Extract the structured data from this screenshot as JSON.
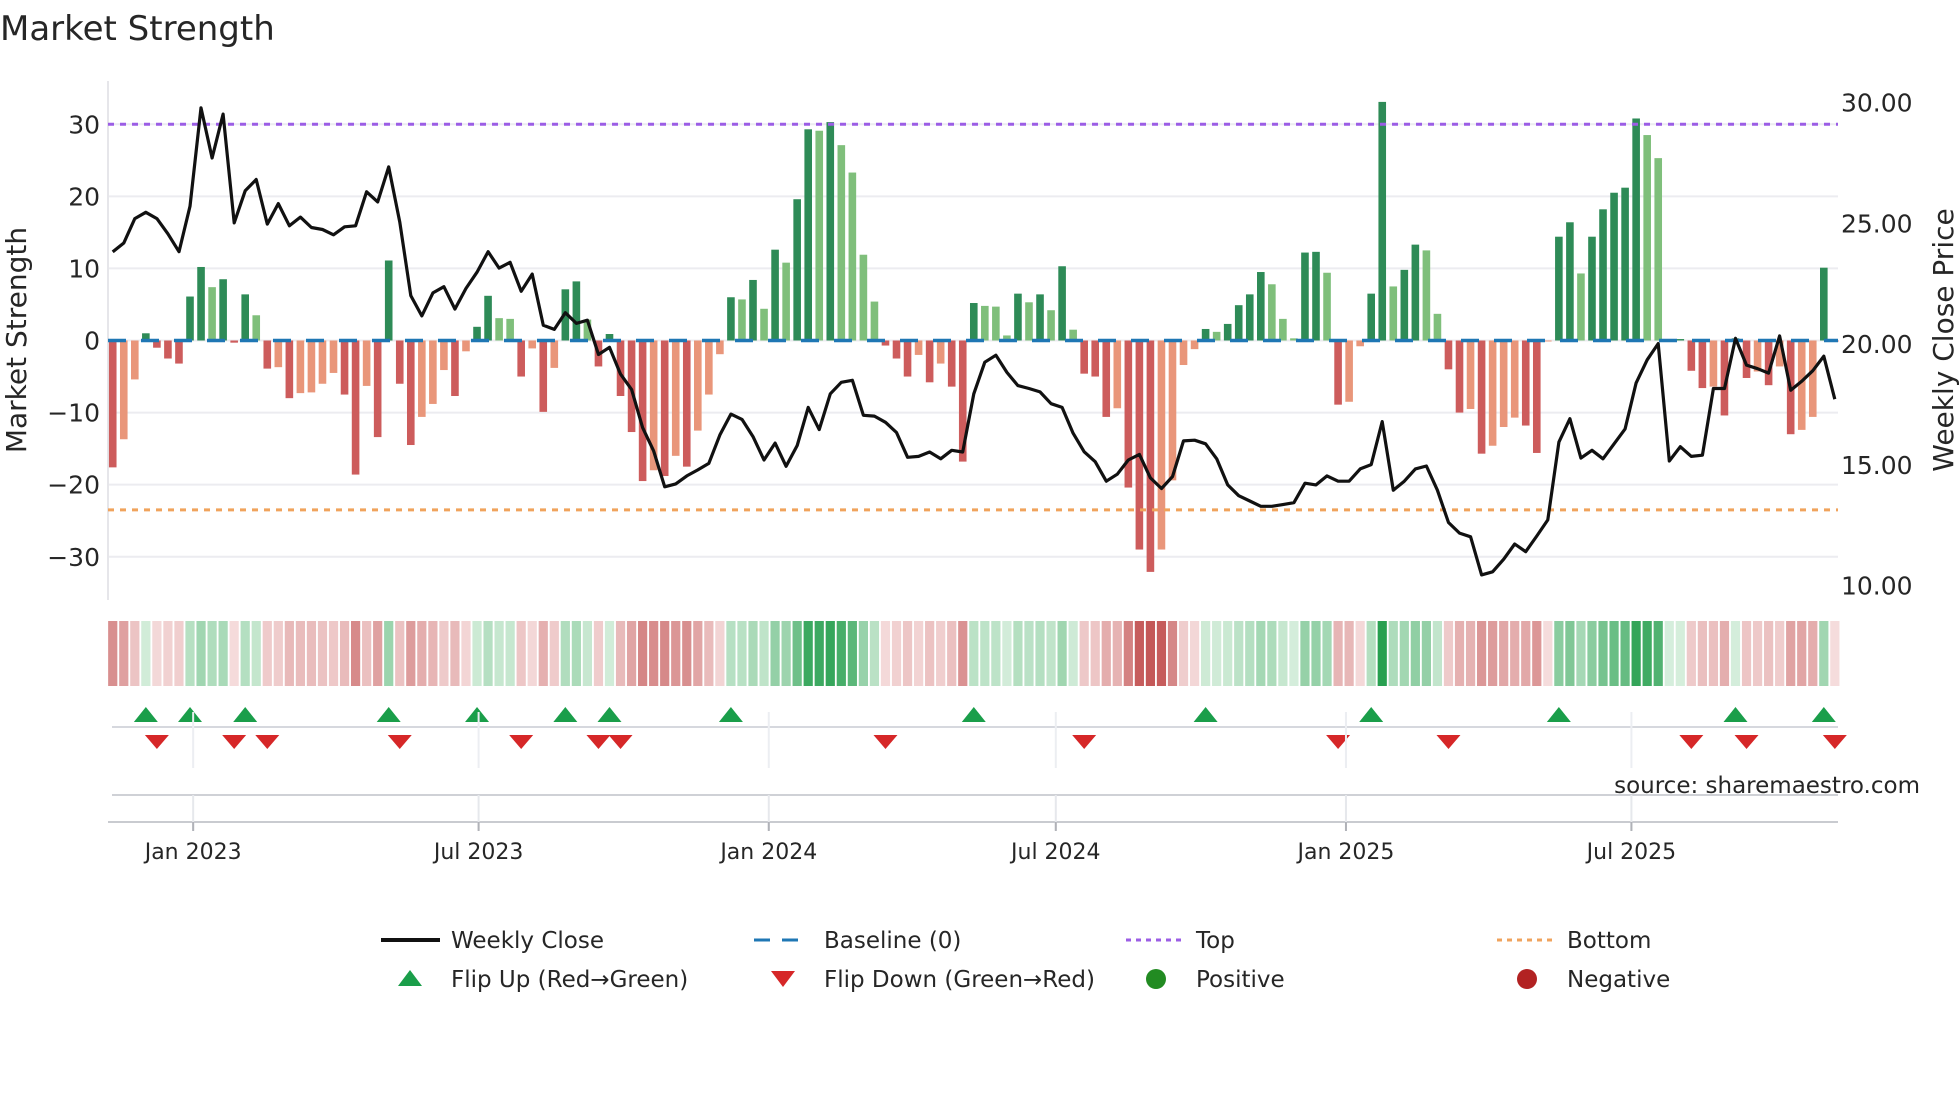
{
  "chart_data": {
    "type": "bar",
    "title": "Market Strength",
    "source": "source: sharemaestro.com",
    "x_start": "2022-11-11",
    "x_step_days": 7,
    "xlim": [
      "2022-11-08",
      "2025-11-09"
    ],
    "xticks": [
      {
        "date": "2023-01-01",
        "label": "Jan 2023"
      },
      {
        "date": "2023-07-01",
        "label": "Jul 2023"
      },
      {
        "date": "2024-01-01",
        "label": "Jan 2024"
      },
      {
        "date": "2024-07-01",
        "label": "Jul 2024"
      },
      {
        "date": "2025-01-01",
        "label": "Jan 2025"
      },
      {
        "date": "2025-07-01",
        "label": "Jul 2025"
      }
    ],
    "left_axis": {
      "label": "Market Strength",
      "ylim": [
        -36,
        36
      ],
      "ticks": [
        30,
        20,
        10,
        0,
        -10,
        -20,
        -30
      ],
      "tick_labels": [
        "30",
        "20",
        "10",
        "0",
        "−10",
        "−20",
        "−30"
      ]
    },
    "right_axis": {
      "label": "Weekly Close Price",
      "ylim": [
        9.4,
        30.9
      ],
      "ticks": [
        30,
        25,
        20,
        15,
        10
      ],
      "tick_labels": [
        "30.00",
        "25.00",
        "20.00",
        "15.00",
        "10.00"
      ]
    },
    "top_level": 30,
    "bottom_level": -23.5,
    "grid": true,
    "colors": {
      "pos_strong": "#2e8b57",
      "pos_weak": "#7fbf7b",
      "neg_strong": "#cd5c5c",
      "neg_weak": "#e9967a",
      "price": "#111111",
      "baseline": "#1f77b4",
      "top": "#9b5de5",
      "bottom": "#f0a35c",
      "flip_up": "#1a9e4a",
      "flip_down": "#d62728",
      "positive": "#228b22",
      "negative": "#b22222"
    },
    "strength": [
      -17.6,
      -13.7,
      -5.4,
      1.0,
      -1.0,
      -2.5,
      -3.2,
      6.1,
      10.2,
      7.4,
      8.5,
      -0.3,
      6.4,
      3.5,
      -3.9,
      -3.7,
      -8.0,
      -7.3,
      -7.2,
      -6.0,
      -4.5,
      -7.5,
      -18.6,
      -6.3,
      -13.4,
      11.1,
      -6.0,
      -14.5,
      -10.6,
      -8.8,
      -4.1,
      -7.7,
      -1.5,
      1.9,
      6.2,
      3.1,
      3.0,
      -5.0,
      -1.1,
      -9.9,
      -3.8,
      7.1,
      8.2,
      2.9,
      -3.6,
      0.9,
      -7.7,
      -12.7,
      -19.5,
      -18.0,
      -18.8,
      -16.0,
      -17.5,
      -12.5,
      -7.5,
      -1.9,
      6.0,
      5.7,
      8.4,
      4.4,
      12.6,
      10.8,
      19.6,
      29.3,
      29.1,
      30.3,
      27.1,
      23.3,
      11.9,
      5.4,
      -0.7,
      -2.5,
      -5.0,
      -2.0,
      -5.8,
      -3.2,
      -6.4,
      -16.8,
      5.2,
      4.8,
      4.7,
      0.7,
      6.5,
      5.3,
      6.4,
      4.2,
      10.3,
      1.5,
      -4.6,
      -5.0,
      -10.6,
      -9.4,
      -20.4,
      -29.0,
      -32.1,
      -29.0,
      -19.4,
      -3.4,
      -1.2,
      1.6,
      1.2,
      2.3,
      4.9,
      6.4,
      9.5,
      7.8,
      3.0,
      0.3,
      12.2,
      12.3,
      9.4,
      -8.9,
      -8.5,
      -0.8,
      6.5,
      33.1,
      7.5,
      9.8,
      13.3,
      12.5,
      3.7,
      -4.0,
      -10.0,
      -9.5,
      -15.7,
      -14.6,
      -12.0,
      -10.7,
      -11.8,
      -15.6,
      -0.1,
      14.4,
      16.4,
      9.3,
      14.4,
      18.2,
      20.5,
      21.2,
      30.8,
      28.5,
      25.3,
      0.1,
      0.2,
      -4.2,
      -6.6,
      -6.4,
      -10.4,
      0.3,
      -5.2,
      -4.3,
      -6.2,
      -3.6,
      -13.0,
      -12.4,
      -10.6,
      10.1,
      -0.1
    ],
    "weekly_close": [
      23.82,
      24.19,
      25.2,
      25.46,
      25.2,
      24.57,
      23.83,
      25.71,
      29.79,
      27.71,
      29.53,
      25.02,
      26.35,
      26.82,
      24.97,
      25.82,
      24.9,
      25.26,
      24.83,
      24.75,
      24.53,
      24.86,
      24.9,
      26.31,
      25.89,
      27.34,
      25.05,
      22.01,
      21.17,
      22.12,
      22.38,
      21.45,
      22.31,
      22.98,
      23.83,
      23.15,
      23.39,
      22.19,
      22.9,
      20.78,
      20.61,
      21.3,
      20.86,
      20.99,
      19.57,
      19.87,
      18.76,
      18.12,
      16.54,
      15.57,
      14.09,
      14.21,
      14.54,
      14.79,
      15.06,
      16.24,
      17.1,
      16.88,
      16.17,
      15.2,
      15.9,
      14.94,
      15.8,
      17.38,
      16.46,
      17.94,
      18.42,
      18.5,
      17.05,
      17.02,
      16.76,
      16.34,
      15.31,
      15.35,
      15.53,
      15.25,
      15.6,
      15.53,
      17.94,
      19.25,
      19.54,
      18.83,
      18.28,
      18.16,
      18.02,
      17.53,
      17.38,
      16.31,
      15.54,
      15.13,
      14.32,
      14.61,
      15.2,
      15.43,
      14.46,
      14.02,
      14.51,
      15.99,
      16.02,
      15.87,
      15.25,
      14.17,
      13.72,
      13.5,
      13.28,
      13.28,
      13.35,
      13.43,
      14.24,
      14.17,
      14.54,
      14.32,
      14.32,
      14.83,
      15.01,
      16.79,
      13.95,
      14.32,
      14.83,
      14.95,
      13.95,
      12.61,
      12.17,
      12.02,
      10.44,
      10.57,
      11.09,
      11.72,
      11.4,
      12.05,
      12.72,
      15.94,
      16.91,
      15.28,
      15.6,
      15.25,
      15.87,
      16.49,
      18.39,
      19.35,
      20.02,
      15.16,
      15.75,
      15.35,
      15.4,
      18.16,
      18.16,
      20.24,
      19.13,
      18.98,
      18.8,
      20.34,
      18.09,
      18.46,
      18.9,
      19.5,
      17.72
    ],
    "legend": {
      "placement": "bottom-center",
      "items": [
        {
          "key": "price",
          "label": "Weekly Close"
        },
        {
          "key": "baseline",
          "label": "Baseline (0)"
        },
        {
          "key": "top",
          "label": "Top"
        },
        {
          "key": "bottom",
          "label": "Bottom"
        },
        {
          "key": "flip_up",
          "label": "Flip Up (Red→Green)"
        },
        {
          "key": "flip_down",
          "label": "Flip Down (Green→Red)"
        },
        {
          "key": "positive",
          "label": "Positive"
        },
        {
          "key": "negative",
          "label": "Negative"
        }
      ]
    }
  }
}
